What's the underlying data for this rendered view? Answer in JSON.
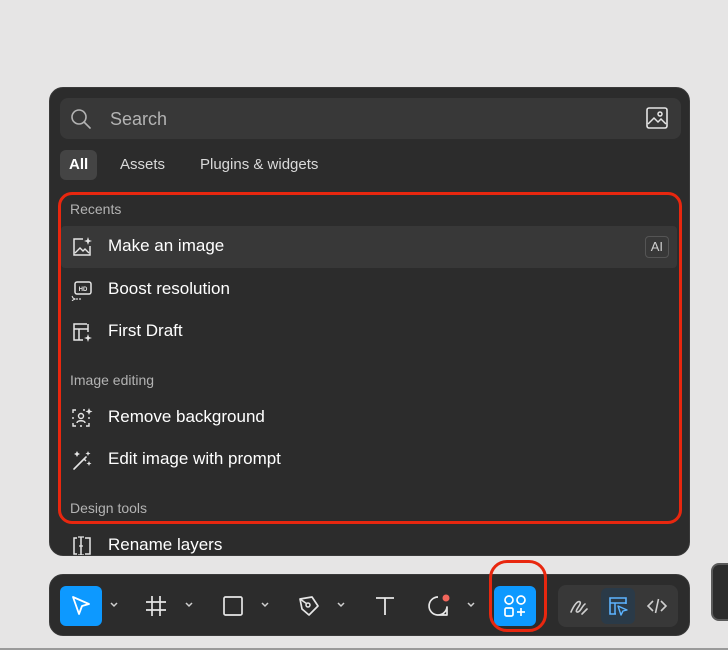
{
  "search": {
    "placeholder": "Search"
  },
  "tabs": [
    {
      "label": "All",
      "active": true
    },
    {
      "label": "Assets",
      "active": false
    },
    {
      "label": "Plugins & widgets",
      "active": false
    }
  ],
  "sections": {
    "recents": "Recents",
    "image_editing": "Image editing",
    "design_tools": "Design tools"
  },
  "items": {
    "make_image": {
      "label": "Make an image",
      "badge": "AI",
      "icon": "image-sparkle-icon"
    },
    "boost_resolution": {
      "label": "Boost resolution",
      "icon": "hd-upscale-icon"
    },
    "first_draft": {
      "label": "First Draft",
      "icon": "layout-sparkle-icon"
    },
    "remove_background": {
      "label": "Remove background",
      "icon": "remove-bg-icon"
    },
    "edit_image": {
      "label": "Edit image with prompt",
      "icon": "magic-wand-icon"
    },
    "rename_layers": {
      "label": "Rename layers",
      "icon": "rename-cursor-icon"
    }
  },
  "toolbar": {
    "tools": [
      "move-tool",
      "frame-tool",
      "rectangle-tool",
      "pen-tool",
      "text-tool",
      "comment-tool",
      "actions-tool"
    ],
    "active_tool": "move-tool",
    "highlighted_tool": "actions-tool",
    "modes": [
      "draw-mode",
      "design-mode",
      "dev-mode"
    ],
    "active_mode": "design-mode"
  },
  "colors": {
    "accent": "#0d99ff",
    "highlight": "#e8270f",
    "panel": "#2c2c2c",
    "background": "#e6e5e5"
  }
}
